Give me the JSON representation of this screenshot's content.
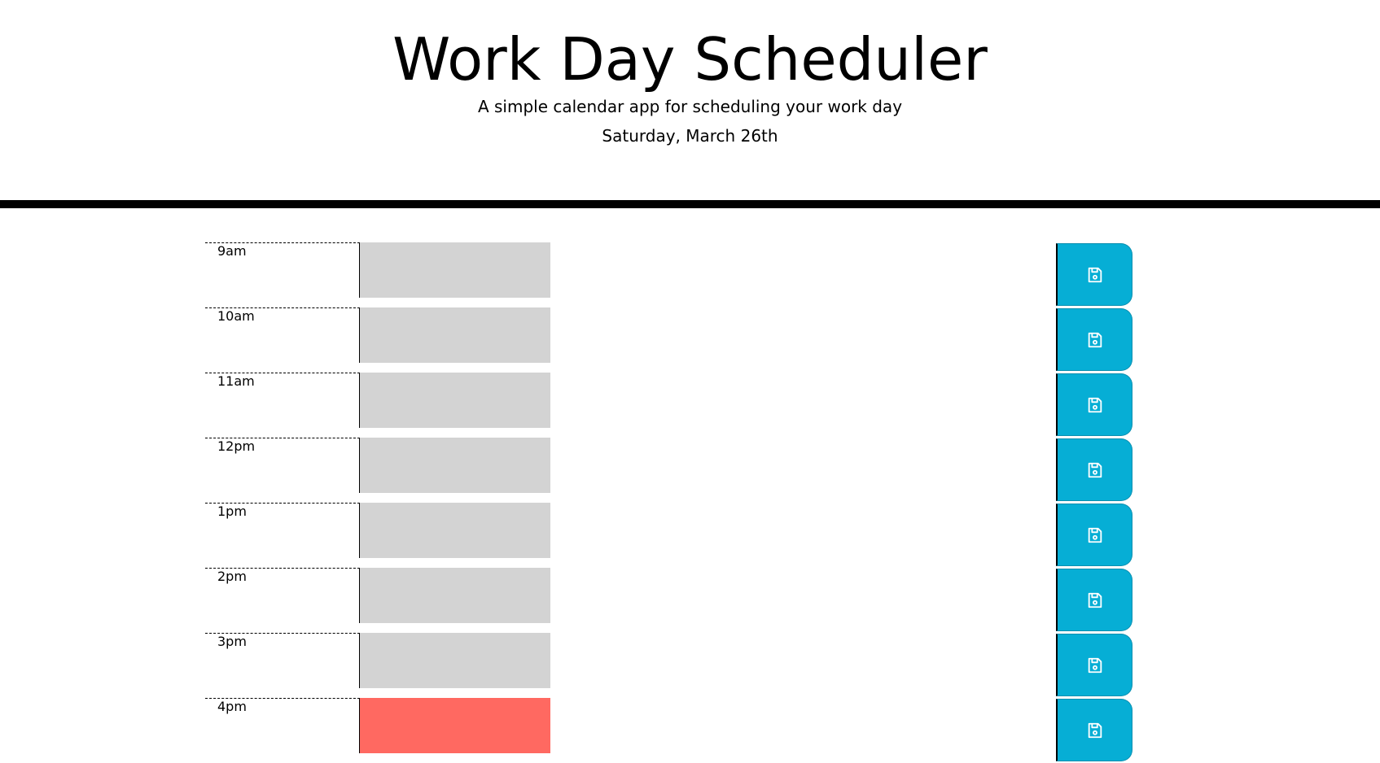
{
  "header": {
    "title": "Work Day Scheduler",
    "subtitle": "A simple calendar app for scheduling your work day",
    "current_day": "Saturday, March 26th"
  },
  "colors": {
    "past": "#d3d3d3",
    "present": "#ff6961",
    "save_button": "#06aed5"
  },
  "timeblocks": [
    {
      "hour": "9am",
      "state": "past",
      "text": "",
      "save_icon": "floppy-disk-icon"
    },
    {
      "hour": "10am",
      "state": "past",
      "text": "",
      "save_icon": "floppy-disk-icon"
    },
    {
      "hour": "11am",
      "state": "past",
      "text": "",
      "save_icon": "floppy-disk-icon"
    },
    {
      "hour": "12pm",
      "state": "past",
      "text": "",
      "save_icon": "floppy-disk-icon"
    },
    {
      "hour": "1pm",
      "state": "past",
      "text": "",
      "save_icon": "floppy-disk-icon"
    },
    {
      "hour": "2pm",
      "state": "past",
      "text": "",
      "save_icon": "floppy-disk-icon"
    },
    {
      "hour": "3pm",
      "state": "past",
      "text": "",
      "save_icon": "floppy-disk-icon"
    },
    {
      "hour": "4pm",
      "state": "present",
      "text": "",
      "save_icon": "floppy-disk-icon"
    }
  ]
}
